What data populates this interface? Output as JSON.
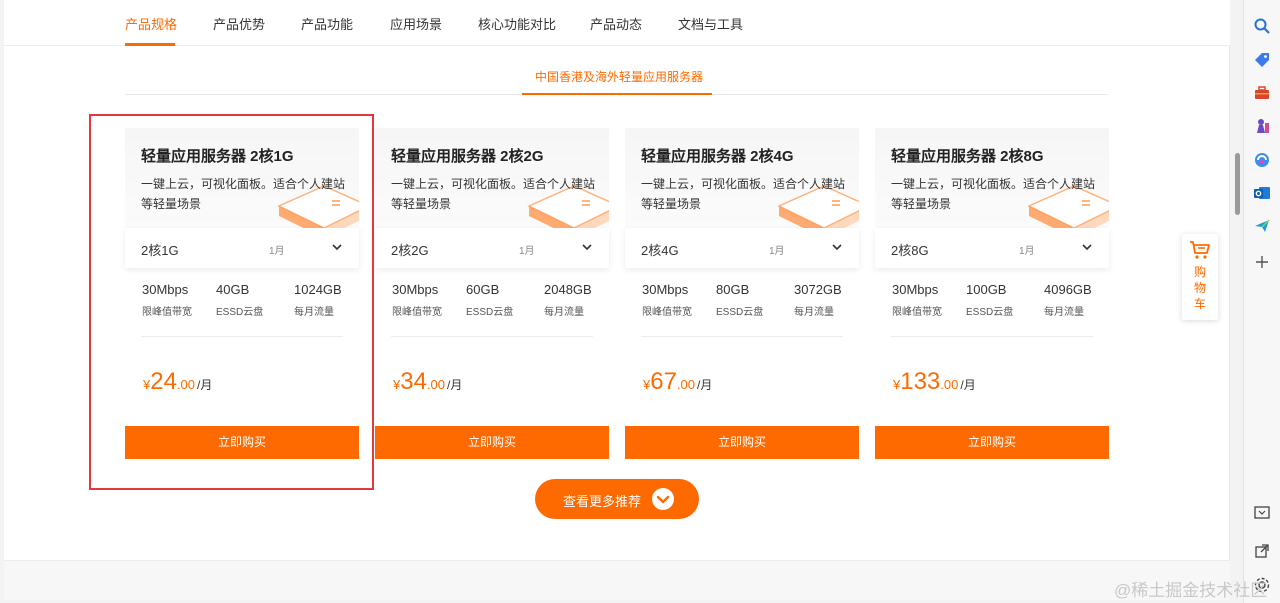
{
  "nav": {
    "items": [
      {
        "label": "产品规格",
        "active": true
      },
      {
        "label": "产品优势"
      },
      {
        "label": "产品功能"
      },
      {
        "label": "应用场景"
      },
      {
        "label": "核心功能对比"
      },
      {
        "label": "产品动态"
      },
      {
        "label": "文档与工具"
      }
    ]
  },
  "region_tab": "中国香港及海外轻量应用服务器",
  "cards": [
    {
      "title": "轻量应用服务器 2核1G",
      "desc": "一键上云，可视化面板。适合个人建站等轻量场景",
      "spec": "2核1G",
      "period": "1月",
      "bandwidth_value": "30Mbps",
      "bandwidth_label": "限峰值带宽",
      "disk_value": "40GB",
      "disk_label": "ESSD云盘",
      "traffic_value": "1024GB",
      "traffic_label": "每月流量",
      "currency": "¥",
      "price_int": "24",
      "price_dec": ".00",
      "price_unit": "/月",
      "buy_label": "立即购买"
    },
    {
      "title": "轻量应用服务器 2核2G",
      "desc": "一键上云，可视化面板。适合个人建站等轻量场景",
      "spec": "2核2G",
      "period": "1月",
      "bandwidth_value": "30Mbps",
      "bandwidth_label": "限峰值带宽",
      "disk_value": "60GB",
      "disk_label": "ESSD云盘",
      "traffic_value": "2048GB",
      "traffic_label": "每月流量",
      "currency": "¥",
      "price_int": "34",
      "price_dec": ".00",
      "price_unit": "/月",
      "buy_label": "立即购买"
    },
    {
      "title": "轻量应用服务器 2核4G",
      "desc": "一键上云，可视化面板。适合个人建站等轻量场景",
      "spec": "2核4G",
      "period": "1月",
      "bandwidth_value": "30Mbps",
      "bandwidth_label": "限峰值带宽",
      "disk_value": "80GB",
      "disk_label": "ESSD云盘",
      "traffic_value": "3072GB",
      "traffic_label": "每月流量",
      "currency": "¥",
      "price_int": "67",
      "price_dec": ".00",
      "price_unit": "/月",
      "buy_label": "立即购买"
    },
    {
      "title": "轻量应用服务器 2核8G",
      "desc": "一键上云，可视化面板。适合个人建站等轻量场景",
      "spec": "2核8G",
      "period": "1月",
      "bandwidth_value": "30Mbps",
      "bandwidth_label": "限峰值带宽",
      "disk_value": "100GB",
      "disk_label": "ESSD云盘",
      "traffic_value": "4096GB",
      "traffic_label": "每月流量",
      "currency": "¥",
      "price_int": "133",
      "price_dec": ".00",
      "price_unit": "/月",
      "buy_label": "立即购买"
    }
  ],
  "more_button": "查看更多推荐",
  "cart": {
    "label": "购物车"
  },
  "right_sidebar": {
    "icons": [
      "search-icon",
      "tag-icon",
      "toolbox-icon",
      "chess-icon",
      "copilot-icon",
      "outlook-icon",
      "send-icon",
      "add-icon",
      "screenshot-icon",
      "external-link-icon",
      "settings-icon"
    ]
  },
  "watermark": "@稀土掘金技术社区",
  "colors": {
    "accent": "#ff6a00",
    "highlight": "#e4393c"
  }
}
